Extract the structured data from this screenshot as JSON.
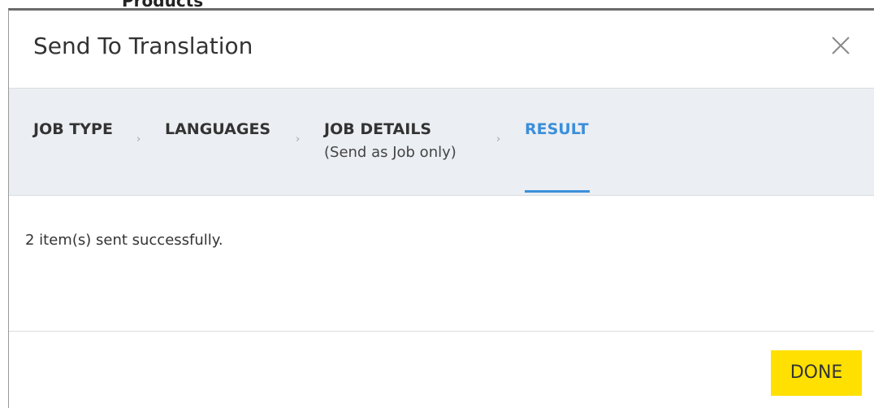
{
  "background": {
    "text": "Products"
  },
  "dialog": {
    "title": "Send To Translation",
    "close_icon": "close-icon"
  },
  "steps": [
    {
      "label": "JOB TYPE",
      "sub": "",
      "active": false
    },
    {
      "label": "LANGUAGES",
      "sub": "",
      "active": false
    },
    {
      "label": "JOB DETAILS",
      "sub": "(Send as Job only)",
      "active": false
    },
    {
      "label": "RESULT",
      "sub": "",
      "active": true
    }
  ],
  "step_separator": "›",
  "result": {
    "message": "2 item(s) sent successfully."
  },
  "footer": {
    "done_label": "DONE"
  },
  "colors": {
    "accent": "#3a8fdb",
    "primary_button": "#ffe000",
    "steps_background": "#ebeef2"
  }
}
